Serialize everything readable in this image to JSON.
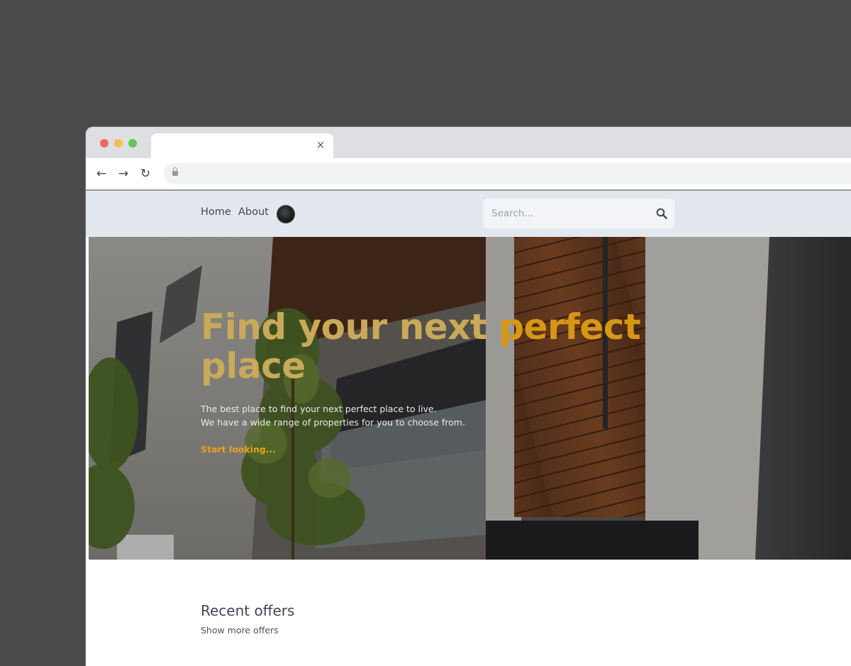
{
  "browser": {
    "tab": {
      "close_glyph": "×"
    },
    "toolbar": {
      "back_glyph": "←",
      "forward_glyph": "→",
      "reload_glyph": "↻",
      "lock_icon": "lock-icon"
    }
  },
  "site_nav": {
    "links": [
      {
        "label": "Home"
      },
      {
        "label": "About"
      }
    ],
    "search": {
      "placeholder": "Search...",
      "value": "",
      "icon": "search-icon"
    }
  },
  "hero": {
    "title_main": "Find your next ",
    "title_accent": "perfect",
    "title_end": " place",
    "description_line1": "The best place to find your next perfect place to live.",
    "description_line2": "We have a wide range of properties for you to choose from.",
    "cta_label": "Start looking..."
  },
  "recent": {
    "title": "Recent offers",
    "link_label": "Show more offers"
  },
  "colors": {
    "background": "#4a4a4c",
    "nav_background": "#e3e8ef",
    "hero_title": "#c9a95a",
    "hero_accent": "#d79714",
    "cta": "#e8a21a",
    "text_dark": "#3f4754"
  }
}
